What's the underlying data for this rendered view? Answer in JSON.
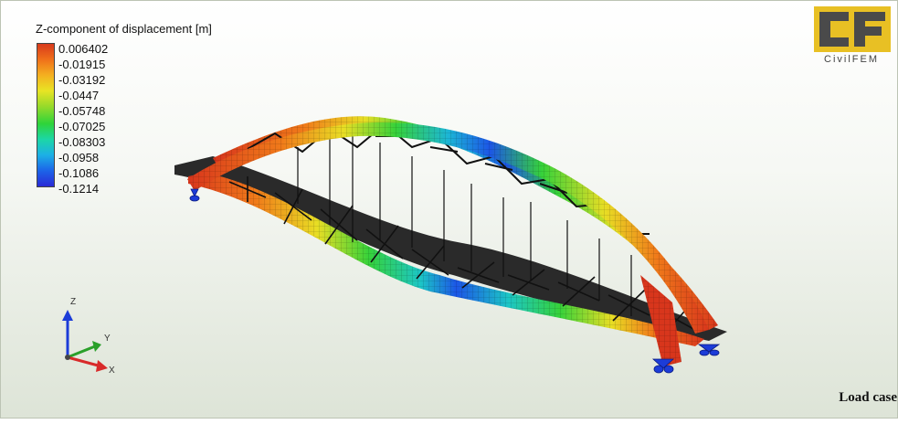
{
  "legend": {
    "title": "Z-component of displacement [m]",
    "values": [
      "0.006402",
      "-0.01915",
      "-0.03192",
      "-0.0447",
      "-0.05748",
      "-0.07025",
      "-0.08303",
      "-0.0958",
      "-0.1086",
      "-0.1214"
    ]
  },
  "logo": {
    "text": "CivilFEM"
  },
  "triad": {
    "z": "Z",
    "y": "Y",
    "x": "X"
  },
  "status": {
    "load_case": "Load case"
  },
  "colors": {
    "red": "#d8361c",
    "orange": "#f07a1a",
    "yellow": "#e8de24",
    "green": "#36d23a",
    "cyan": "#1cc6c6",
    "blue": "#1c56e6"
  }
}
